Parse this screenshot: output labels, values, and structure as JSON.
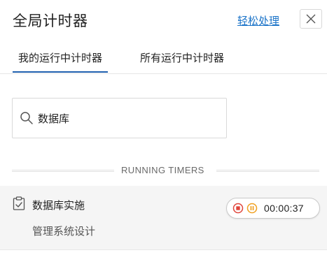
{
  "header": {
    "title": "全局计时器",
    "link_label": "轻松处理",
    "close_icon": "close-icon"
  },
  "tabs": [
    {
      "label": "我的运行中计时器",
      "active": true
    },
    {
      "label": "所有运行中计时器",
      "active": false
    }
  ],
  "search": {
    "value": "数据库",
    "icon": "search-icon"
  },
  "section": {
    "label": "RUNNING TIMERS"
  },
  "timers": [
    {
      "name": "数据库实施",
      "project": "管理系统设计",
      "elapsed": "00:00:37",
      "icons": [
        "clipboard-icon",
        "stop-icon",
        "pause-icon"
      ]
    }
  ],
  "colors": {
    "link": "#1a73c8",
    "tab_active_underline": "#1f5fae",
    "stop": "#e0443a",
    "pause": "#f0a020",
    "row_background": "#f5f5f5"
  }
}
